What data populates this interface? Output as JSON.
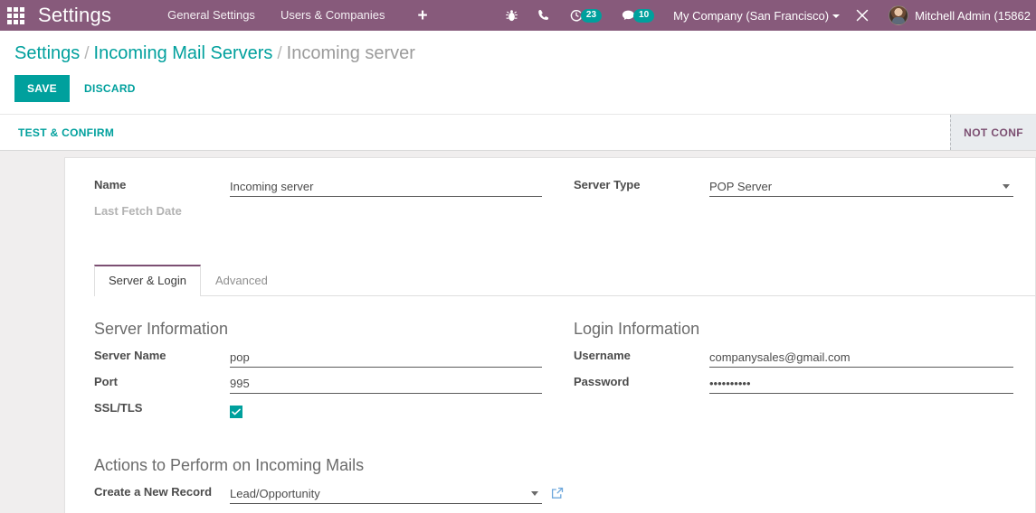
{
  "navbar": {
    "apps_icon": "apps-grid-icon",
    "brand": "Settings",
    "menu": [
      {
        "label": "General Settings"
      },
      {
        "label": "Users & Companies"
      }
    ],
    "plus": "+",
    "icons": [
      {
        "name": "bug-icon"
      },
      {
        "name": "phone-icon"
      },
      {
        "name": "activity-clock-icon",
        "badge": "23"
      },
      {
        "name": "messages-icon",
        "badge": "10"
      }
    ],
    "company": "My Company (San Francisco)",
    "tools_icon": "tools-icon",
    "user": "Mitchell Admin (15862",
    "badge_color": "#00a09d",
    "background": "#875a7b"
  },
  "breadcrumb": {
    "root": "Settings",
    "parent": "Incoming Mail Servers",
    "current": "Incoming server",
    "separator": "/"
  },
  "control_panel": {
    "save_label": "SAVE",
    "discard_label": "DISCARD",
    "accent": "#00a09d"
  },
  "statusbar": {
    "test_confirm_label": "TEST & CONFIRM",
    "stage": "NOT CONF",
    "stage_color": "#7c4f72"
  },
  "form": {
    "name_label": "Name",
    "name_value": "Incoming server",
    "last_fetch_label": "Last Fetch Date",
    "last_fetch_value": "",
    "server_type_label": "Server Type",
    "server_type_value": "POP Server"
  },
  "notebook": {
    "tabs": [
      {
        "label": "Server & Login",
        "active": true
      },
      {
        "label": "Advanced",
        "active": false
      }
    ]
  },
  "server_information": {
    "title": "Server Information",
    "server_name_label": "Server Name",
    "server_name_value": "pop",
    "port_label": "Port",
    "port_value": "995",
    "ssl_label": "SSL/TLS",
    "ssl_checked": true
  },
  "login_information": {
    "title": "Login Information",
    "username_label": "Username",
    "username_value": "companysales@gmail.com",
    "password_label": "Password",
    "password_value": "••••••••••"
  },
  "actions_section": {
    "title": "Actions to Perform on Incoming Mails",
    "create_record_label": "Create a New Record",
    "create_record_value": "Lead/Opportunity",
    "external_link_icon": "external-link-icon"
  }
}
